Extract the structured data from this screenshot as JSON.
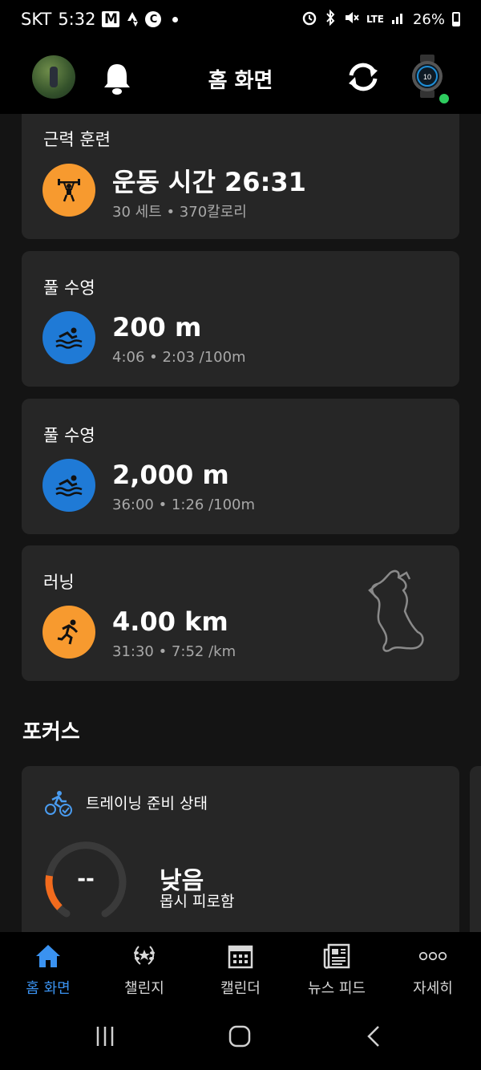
{
  "status_bar": {
    "carrier": "SKT",
    "time": "5:32",
    "network": "LTE",
    "battery": "26%"
  },
  "header": {
    "title": "홈 화면"
  },
  "activities": [
    {
      "type": "근력 훈련",
      "main": "운동 시간 26:31",
      "sub": "30 세트 • 370칼로리",
      "icon": "strength-icon",
      "color": "#f79a2f"
    },
    {
      "type": "풀 수영",
      "main": "200 m",
      "sub": "4:06 • 2:03 /100m",
      "icon": "swim-icon",
      "color": "#1f7ad6"
    },
    {
      "type": "풀 수영",
      "main": "2,000 m",
      "sub": "36:00 • 1:26 /100m",
      "icon": "swim-icon",
      "color": "#1f7ad6"
    },
    {
      "type": "러닝",
      "main": "4.00 km",
      "sub": "31:30 • 7:52 /km",
      "icon": "run-icon",
      "color": "#f79a2f"
    }
  ],
  "focus": {
    "section_title": "포커스",
    "card_title": "트레이닝 준비 상태",
    "gauge_value": "--",
    "status": "낮음",
    "description": "몹시 피로함",
    "gauge_level": 0.2
  },
  "bottom_nav": [
    {
      "label": "홈 화면",
      "icon": "home-icon",
      "active": true
    },
    {
      "label": "챌린지",
      "icon": "laurel-icon",
      "active": false
    },
    {
      "label": "캘린더",
      "icon": "calendar-icon",
      "active": false
    },
    {
      "label": "뉴스 피드",
      "icon": "newsfeed-icon",
      "active": false
    },
    {
      "label": "자세히",
      "icon": "more-icon",
      "active": false
    }
  ],
  "colors": {
    "accent_blue": "#3a92f0",
    "orange": "#f79a2f",
    "blue": "#1f7ad6",
    "card_bg": "#262626",
    "online_green": "#2ecc5f"
  }
}
